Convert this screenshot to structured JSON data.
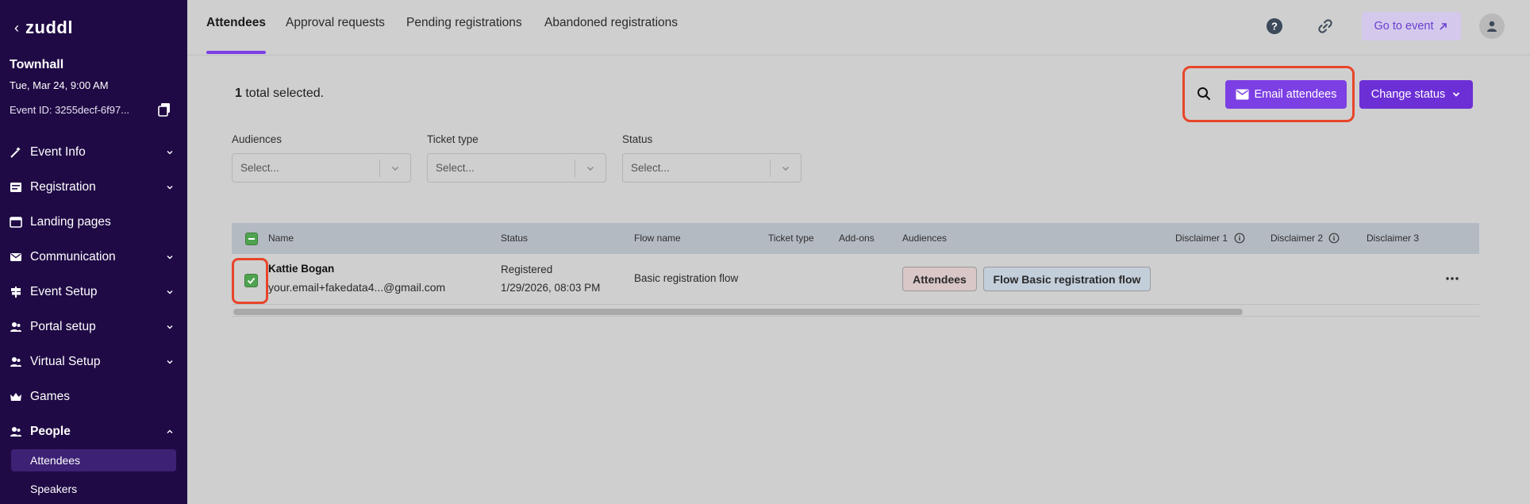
{
  "sidebar": {
    "brand": "zuddl",
    "event_name": "Townhall",
    "event_date": "Tue, Mar 24, 9:00 AM",
    "event_id": "Event ID: 3255decf-6f97...",
    "items": [
      {
        "label": "Event Info",
        "icon": "wand-icon",
        "expandable": true
      },
      {
        "label": "Registration",
        "icon": "form-icon",
        "expandable": true
      },
      {
        "label": "Landing pages",
        "icon": "browser-icon",
        "expandable": false
      },
      {
        "label": "Communication",
        "icon": "mail-icon",
        "expandable": true
      },
      {
        "label": "Event Setup",
        "icon": "signpost-icon",
        "expandable": true
      },
      {
        "label": "Portal setup",
        "icon": "people-icon",
        "expandable": true
      },
      {
        "label": "Virtual Setup",
        "icon": "people-icon",
        "expandable": true
      },
      {
        "label": "Games",
        "icon": "crown-icon",
        "expandable": false
      },
      {
        "label": "People",
        "icon": "people-icon",
        "expandable": true,
        "expanded": true
      }
    ],
    "people_sub": [
      "Attendees",
      "Speakers"
    ]
  },
  "tabs": [
    "Attendees",
    "Approval requests",
    "Pending registrations",
    "Abandoned registrations"
  ],
  "header": {
    "go_to_event": "Go to event"
  },
  "toolbar": {
    "selected_count": "1",
    "selected_suffix": " total selected.",
    "email_label": "Email attendees",
    "status_label": "Change status"
  },
  "filters": [
    {
      "label": "Audiences",
      "placeholder": "Select..."
    },
    {
      "label": "Ticket type",
      "placeholder": "Select..."
    },
    {
      "label": "Status",
      "placeholder": "Select..."
    }
  ],
  "table": {
    "columns": [
      "Name",
      "Status",
      "Flow name",
      "Ticket type",
      "Add-ons",
      "Audiences",
      "Disclaimer 1",
      "Disclaimer 2",
      "Disclaimer 3"
    ],
    "rows": [
      {
        "name": "Kattie Bogan",
        "email": "your.email+fakedata4...@gmail.com",
        "status": "Registered",
        "date": "1/29/2026, 08:03 PM",
        "flow": "Basic registration flow",
        "audiences": [
          "Attendees",
          "Flow Basic registration flow"
        ]
      }
    ]
  },
  "colors": {
    "sidebar_bg": "#1f0a45",
    "accent": "#7b3fe4",
    "highlight": "#e8452a",
    "check_green": "#4fa350"
  }
}
